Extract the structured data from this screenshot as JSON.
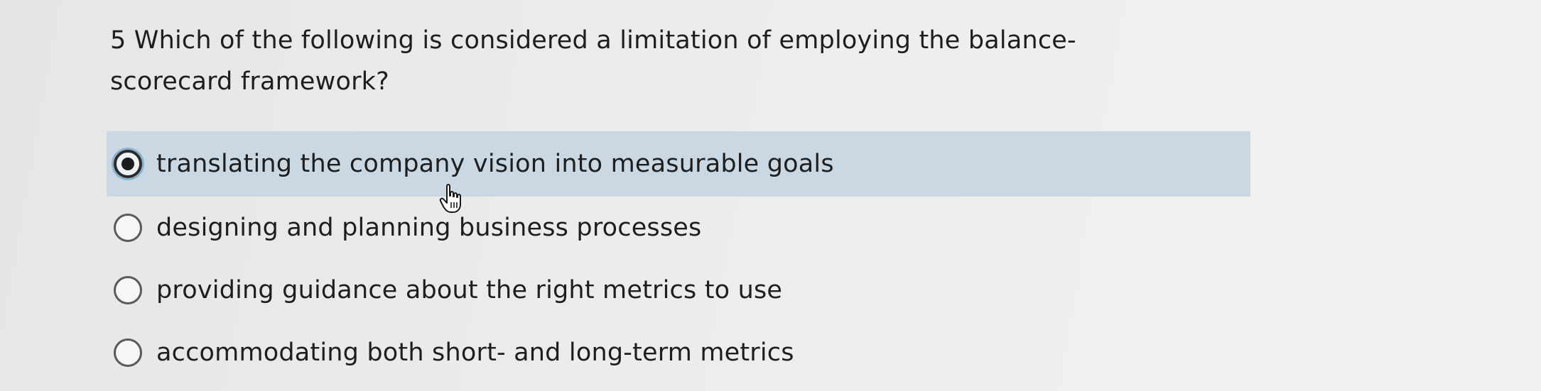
{
  "question": {
    "text": "5 Which of the following is considered a limitation of employing the balance-scorecard framework?"
  },
  "options": [
    {
      "label": "translating the company vision into measurable goals",
      "selected": true
    },
    {
      "label": "designing and planning business processes",
      "selected": false
    },
    {
      "label": "providing guidance about the right metrics to use",
      "selected": false
    },
    {
      "label": "accommodating both short- and long-term metrics",
      "selected": false
    }
  ],
  "colors": {
    "selected_background": "#c9d8e3",
    "page_background": "#ececea",
    "text": "#1e1e1e"
  },
  "cursor": {
    "icon": "hand-pointer-icon"
  }
}
